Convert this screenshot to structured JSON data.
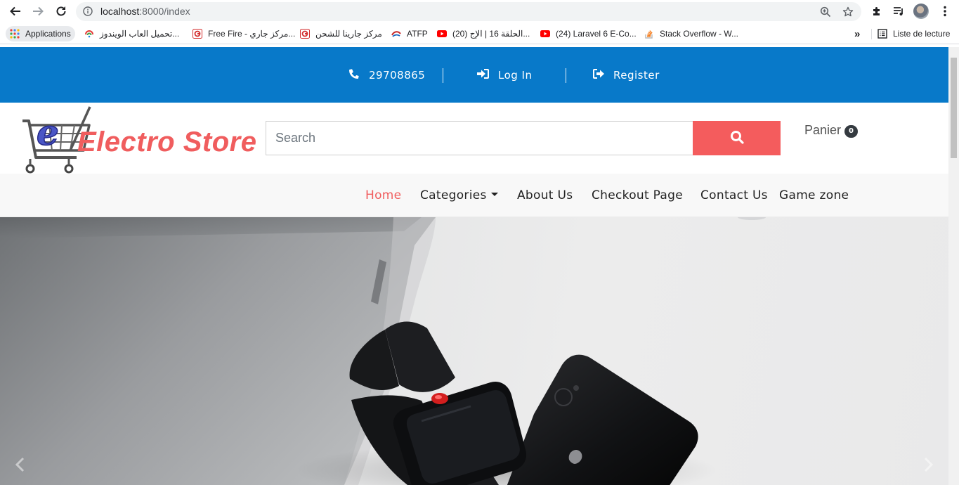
{
  "browser": {
    "url_host": "localhost",
    "url_rest": ":8000/index",
    "bookmarks": [
      {
        "label": "Applications",
        "icon": "apps-grid-icon"
      },
      {
        "label": "تحميل العاب الويندوز...",
        "icon": "site-favicon"
      },
      {
        "label": "Free Fire - مركز جاري...",
        "icon": "garena-icon"
      },
      {
        "label": "مركز جارينا للشحن",
        "icon": "garena-icon"
      },
      {
        "label": "ATFP",
        "icon": "atfp-icon"
      },
      {
        "label": "(20) الحلقة 16 | الإج...",
        "icon": "youtube-icon"
      },
      {
        "label": "(24) Laravel 6 E-Co...",
        "icon": "youtube-icon"
      },
      {
        "label": "Stack Overflow - W...",
        "icon": "stackoverflow-icon"
      }
    ],
    "more_bookmarks": "»",
    "reading_list": "Liste de lecture"
  },
  "topbar": {
    "phone": "29708865",
    "login": "Log In",
    "register": "Register",
    "color": "#0879c9"
  },
  "header": {
    "logo_text": "Electro Store",
    "search_placeholder": "Search",
    "cart_label": "Panier",
    "cart_count": "0",
    "accent": "#f45c5d"
  },
  "nav": {
    "items": [
      {
        "label": "Home",
        "active": true
      },
      {
        "label": "Categories"
      },
      {
        "label": "About Us"
      },
      {
        "label": "Checkout Page"
      },
      {
        "label": "Contact Us"
      },
      {
        "label": "Game zone"
      }
    ]
  }
}
